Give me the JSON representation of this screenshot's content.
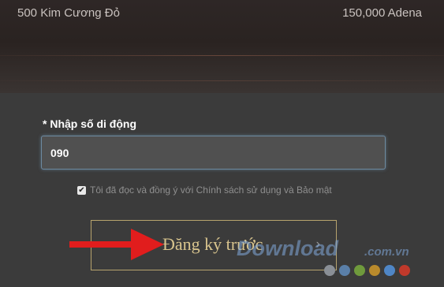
{
  "rewards": {
    "left": "500 Kim Cương Đỏ",
    "right": "150,000 Adena"
  },
  "form": {
    "phone_label": "* Nhập số di động",
    "phone_value": "090",
    "agree_text": "Tôi đã đọc và đồng ý với Chính sách sử dụng và Bảo mật",
    "agree_checked": true,
    "register_label": "Đăng ký trước",
    "register_chevron": "›"
  },
  "watermark": {
    "text": "Download",
    "suffix": ".com.vn",
    "dot_colors": [
      "#8a8f96",
      "#5a7fa8",
      "#6f9a3c",
      "#b98a2c",
      "#4f86c6",
      "#c0392b"
    ]
  },
  "annotation": {
    "arrow_color": "#e11d1d",
    "arrow_icon": "red-arrow-icon"
  },
  "colors": {
    "accent_gold": "#d9c58e",
    "input_focus": "#6d8aa0"
  }
}
